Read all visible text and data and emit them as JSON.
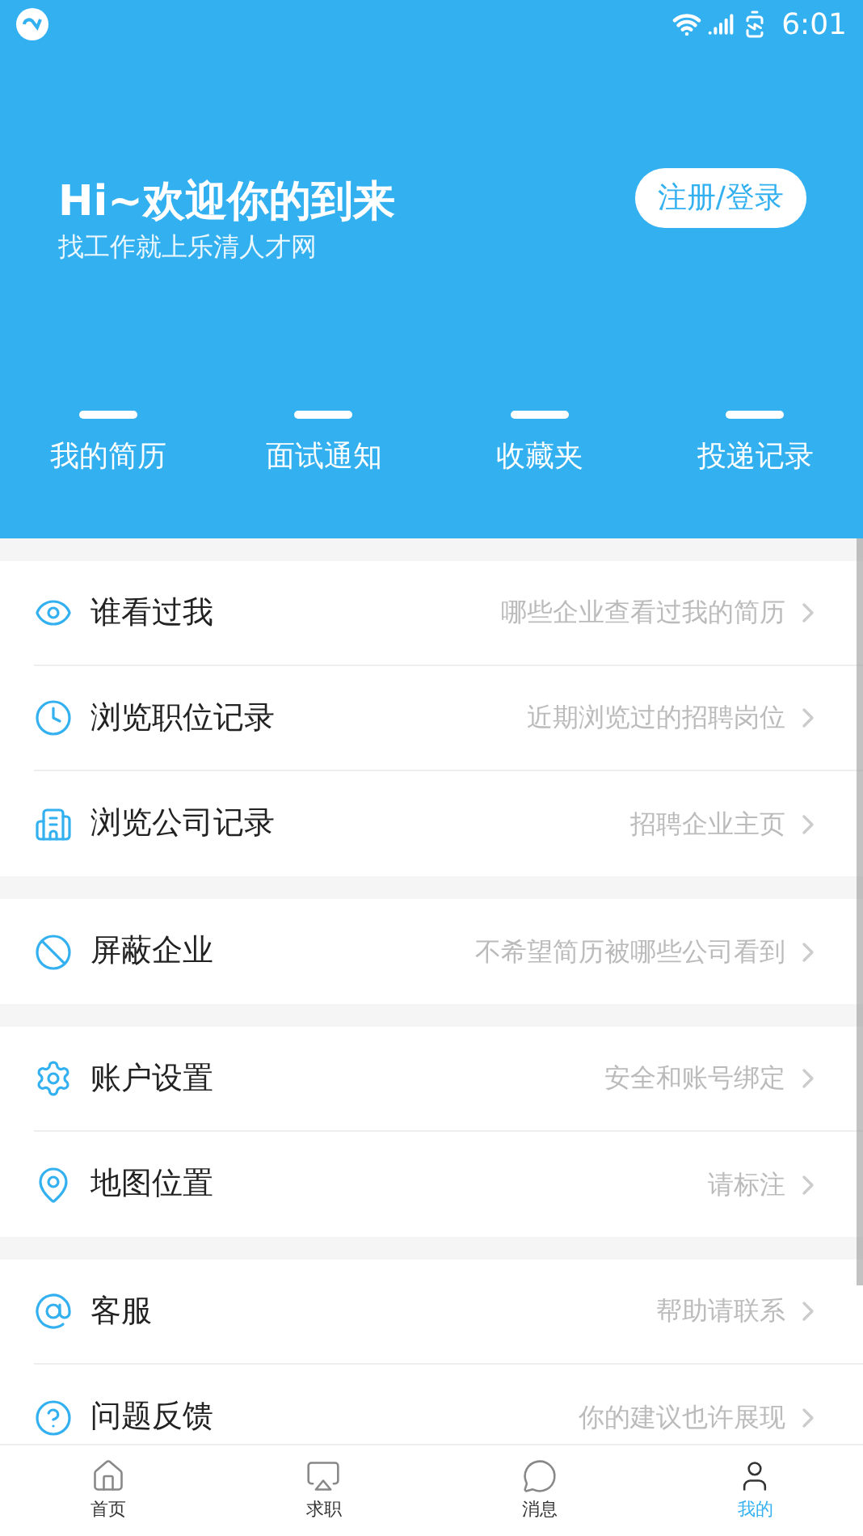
{
  "status_bar": {
    "time": "6:01"
  },
  "header": {
    "title": "Hi~欢迎你的到来",
    "subtitle": "找工作就上乐清人才网",
    "login_button": "注册/登录"
  },
  "quick_links": [
    {
      "label": "我的简历"
    },
    {
      "label": "面试通知"
    },
    {
      "label": "收藏夹"
    },
    {
      "label": "投递记录"
    }
  ],
  "sections": [
    {
      "items": [
        {
          "label": "谁看过我",
          "hint": "哪些企业查看过我的简历"
        },
        {
          "label": "浏览职位记录",
          "hint": "近期浏览过的招聘岗位"
        },
        {
          "label": "浏览公司记录",
          "hint": "招聘企业主页"
        }
      ]
    },
    {
      "items": [
        {
          "label": "屏蔽企业",
          "hint": "不希望简历被哪些公司看到"
        }
      ]
    },
    {
      "items": [
        {
          "label": "账户设置",
          "hint": "安全和账号绑定"
        },
        {
          "label": "地图位置",
          "hint": "请标注"
        }
      ]
    },
    {
      "items": [
        {
          "label": "客服",
          "hint": "帮助请联系"
        },
        {
          "label": "问题反馈",
          "hint": "你的建议也许展现"
        }
      ]
    }
  ],
  "bottom_nav": [
    {
      "label": "首页",
      "selected": false
    },
    {
      "label": "求职",
      "selected": false
    },
    {
      "label": "消息",
      "selected": false
    },
    {
      "label": "我的",
      "selected": true
    }
  ]
}
